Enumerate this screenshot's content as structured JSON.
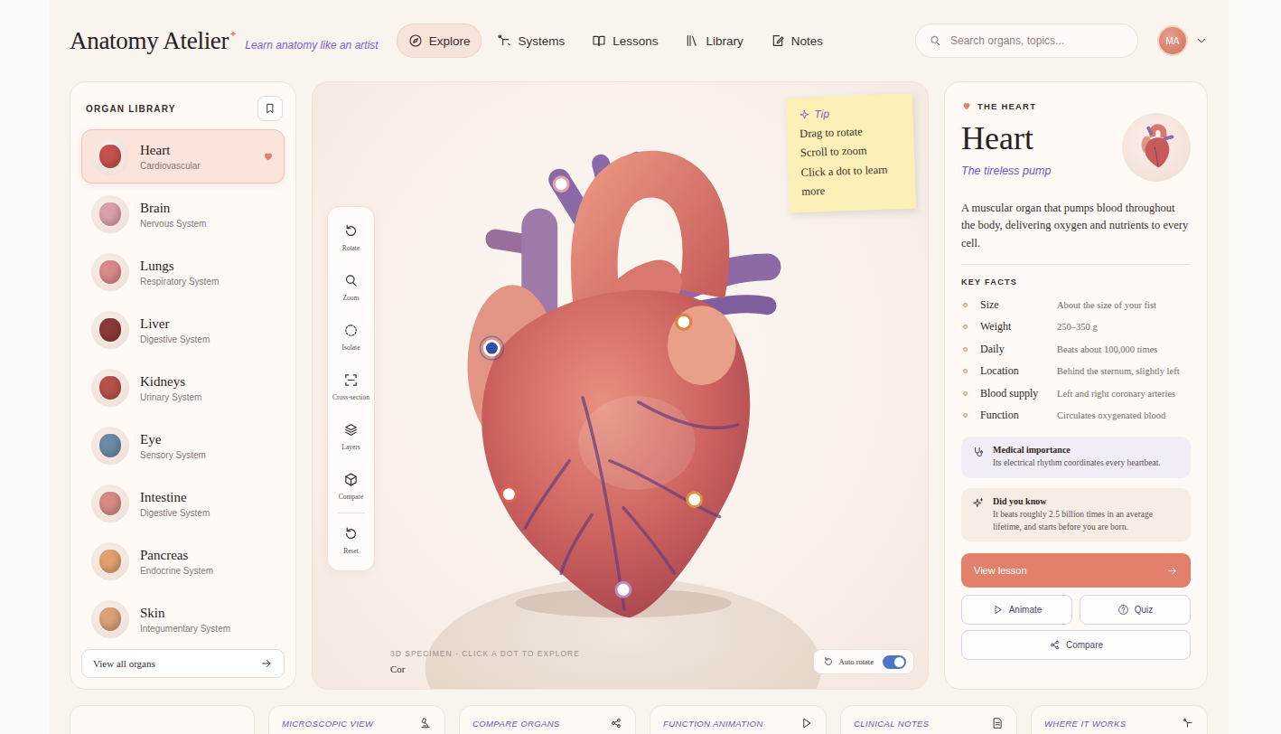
{
  "brand": {
    "name": "Anatomy Atelier",
    "mark": "✦",
    "tagline": "Learn anatomy like an artist"
  },
  "nav": [
    {
      "label": "Explore",
      "selected": true
    },
    {
      "label": "Systems",
      "selected": false
    },
    {
      "label": "Lessons",
      "selected": false
    },
    {
      "label": "Library",
      "selected": false
    },
    {
      "label": "Notes",
      "selected": false
    }
  ],
  "search": {
    "placeholder": "Search organs, topics..."
  },
  "user": {
    "initials": "MA"
  },
  "library": {
    "title": "ORGAN LIBRARY",
    "items": [
      {
        "name": "Heart",
        "system": "Cardiovascular",
        "selected": true,
        "favorite": true,
        "color": "#c4524f"
      },
      {
        "name": "Brain",
        "system": "Nervous System",
        "selected": false,
        "favorite": false,
        "color": "#d9a0a8"
      },
      {
        "name": "Lungs",
        "system": "Respiratory System",
        "selected": false,
        "favorite": false,
        "color": "#d98a88"
      },
      {
        "name": "Liver",
        "system": "Digestive System",
        "selected": false,
        "favorite": false,
        "color": "#8a3a36"
      },
      {
        "name": "Kidneys",
        "system": "Urinary System",
        "selected": false,
        "favorite": false,
        "color": "#b8504a"
      },
      {
        "name": "Eye",
        "system": "Sensory System",
        "selected": false,
        "favorite": false,
        "color": "#6b8aa8"
      },
      {
        "name": "Intestine",
        "system": "Digestive System",
        "selected": false,
        "favorite": false,
        "color": "#d68a84"
      },
      {
        "name": "Pancreas",
        "system": "Endocrine System",
        "selected": false,
        "favorite": false,
        "color": "#e0a070"
      },
      {
        "name": "Skin",
        "system": "Integumentary System",
        "selected": false,
        "favorite": false,
        "color": "#d9a07a"
      }
    ],
    "footer": "View all organs"
  },
  "tools": [
    "Rotate",
    "Zoom",
    "Isolate",
    "Cross-section",
    "Layers",
    "Compare",
    "Reset"
  ],
  "tip": {
    "title": "Tip",
    "lines": [
      "Drag to rotate",
      "Scroll to zoom",
      "Click a dot to learn more"
    ]
  },
  "hotspots": [
    {
      "selected": false,
      "color": "#e6a1a8"
    },
    {
      "selected": true,
      "color": "#2f4ea8"
    },
    {
      "selected": false,
      "color": "#e08040"
    },
    {
      "selected": false,
      "color": "#e0604e"
    },
    {
      "selected": false,
      "color": "#e09040"
    },
    {
      "selected": false,
      "color": "#b98bc4"
    }
  ],
  "specimen": {
    "caption": "3D SPECIMEN · CLICK A DOT TO EXPLORE",
    "name": "Cor"
  },
  "autoRotate": {
    "label": "Auto rotate",
    "on": true
  },
  "detail": {
    "eyebrow": "THE HEART",
    "title": "Heart",
    "subtitle": "The tireless pump",
    "description": "A muscular organ that pumps blood throughout the body, delivering oxygen and nutrients to every cell.",
    "factsTitle": "KEY FACTS",
    "facts": [
      {
        "label": "Size",
        "value": "About the size of your fist"
      },
      {
        "label": "Weight",
        "value": "250–350 g"
      },
      {
        "label": "Daily",
        "value": "Beats about 100,000 times"
      },
      {
        "label": "Location",
        "value": "Behind the sternum, slightly left"
      },
      {
        "label": "Blood supply",
        "value": "Left and right coronary arteries"
      },
      {
        "label": "Function",
        "value": "Circulates oxygenated blood"
      }
    ],
    "notes": [
      {
        "title": "Medical importance",
        "text": "Its electrical rhythm coordinates every heartbeat."
      },
      {
        "title": "Did you know",
        "text": "It beats roughly 2.5 billion times in an average lifetime, and starts before you are born."
      }
    ],
    "primaryAction": "View lesson",
    "actions": [
      "Animate",
      "Quiz"
    ],
    "compare": "Compare"
  },
  "strip": [
    "MICROSCOPIC VIEW",
    "COMPARE ORGANS",
    "FUNCTION ANIMATION",
    "CLINICAL NOTES",
    "WHERE IT WORKS"
  ]
}
